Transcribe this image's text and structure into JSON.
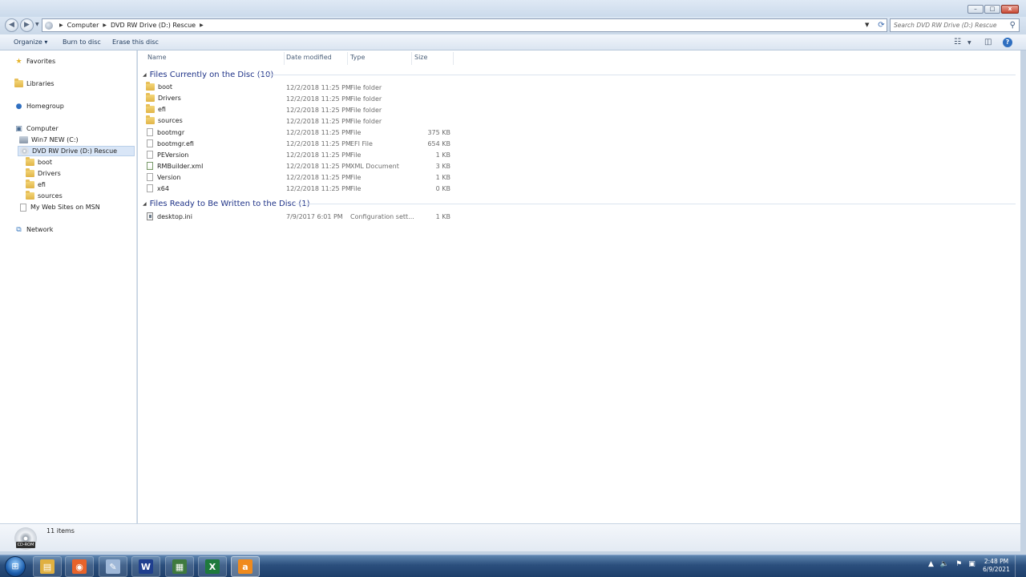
{
  "window": {
    "min_glyph": "–",
    "max_glyph": "□",
    "close_glyph": "x"
  },
  "address": {
    "crumbs": [
      "Computer",
      "DVD RW Drive (D:) Rescue"
    ],
    "search_placeholder": "Search DVD RW Drive (D:) Rescue"
  },
  "commands": {
    "organize": "Organize ▾",
    "burn": "Burn to disc",
    "erase": "Erase this disc"
  },
  "nav": {
    "favorites": "Favorites",
    "libraries": "Libraries",
    "homegroup": "Homegroup",
    "computer": "Computer",
    "drive_c": "Win7 NEW (C:)",
    "drive_d": "DVD RW Drive (D:) Rescue",
    "sub_folders": [
      "boot",
      "Drivers",
      "efi",
      "sources"
    ],
    "msn": "My Web Sites on MSN",
    "network": "Network"
  },
  "columns": {
    "name": "Name",
    "date": "Date modified",
    "type": "Type",
    "size": "Size"
  },
  "groups": [
    {
      "title": "Files Currently on the Disc (10)",
      "rows": [
        {
          "name": "boot",
          "icon": "folder",
          "date": "12/2/2018 11:25 PM",
          "type": "File folder",
          "size": ""
        },
        {
          "name": "Drivers",
          "icon": "folder",
          "date": "12/2/2018 11:25 PM",
          "type": "File folder",
          "size": ""
        },
        {
          "name": "efi",
          "icon": "folder",
          "date": "12/2/2018 11:25 PM",
          "type": "File folder",
          "size": ""
        },
        {
          "name": "sources",
          "icon": "folder",
          "date": "12/2/2018 11:25 PM",
          "type": "File folder",
          "size": ""
        },
        {
          "name": "bootmgr",
          "icon": "file",
          "date": "12/2/2018 11:25 PM",
          "type": "File",
          "size": "375 KB"
        },
        {
          "name": "bootmgr.efi",
          "icon": "file",
          "date": "12/2/2018 11:25 PM",
          "type": "EFI File",
          "size": "654 KB"
        },
        {
          "name": "PEVersion",
          "icon": "file",
          "date": "12/2/2018 11:25 PM",
          "type": "File",
          "size": "1 KB"
        },
        {
          "name": "RMBuilder.xml",
          "icon": "xml",
          "date": "12/2/2018 11:25 PM",
          "type": "XML Document",
          "size": "3 KB"
        },
        {
          "name": "Version",
          "icon": "file",
          "date": "12/2/2018 11:25 PM",
          "type": "File",
          "size": "1 KB"
        },
        {
          "name": "x64",
          "icon": "file",
          "date": "12/2/2018 11:25 PM",
          "type": "File",
          "size": "0 KB"
        }
      ]
    },
    {
      "title": "Files Ready to Be Written to the Disc (1)",
      "rows": [
        {
          "name": "desktop.ini",
          "icon": "cfg",
          "date": "7/9/2017 6:01 PM",
          "type": "Configuration sett...",
          "size": "1 KB"
        }
      ]
    }
  ],
  "details": {
    "count": "11 items",
    "cd_label": "CD-ROM"
  },
  "taskbar": {
    "apps": [
      {
        "name": "explorer",
        "glyph": "▤",
        "color": "#e0b040"
      },
      {
        "name": "firefox",
        "glyph": "◉",
        "color": "#e8632a"
      },
      {
        "name": "paint",
        "glyph": "✎",
        "color": "#9fb8d8"
      },
      {
        "name": "word",
        "glyph": "W",
        "color": "#1f3f8f"
      },
      {
        "name": "control-panel",
        "glyph": "▦",
        "color": "#3f7a3f"
      },
      {
        "name": "excel",
        "glyph": "X",
        "color": "#1e7a3c"
      },
      {
        "name": "app-orange",
        "glyph": "a",
        "color": "#f08a1c"
      }
    ],
    "time": "2:48 PM",
    "date": "6/9/2021"
  }
}
